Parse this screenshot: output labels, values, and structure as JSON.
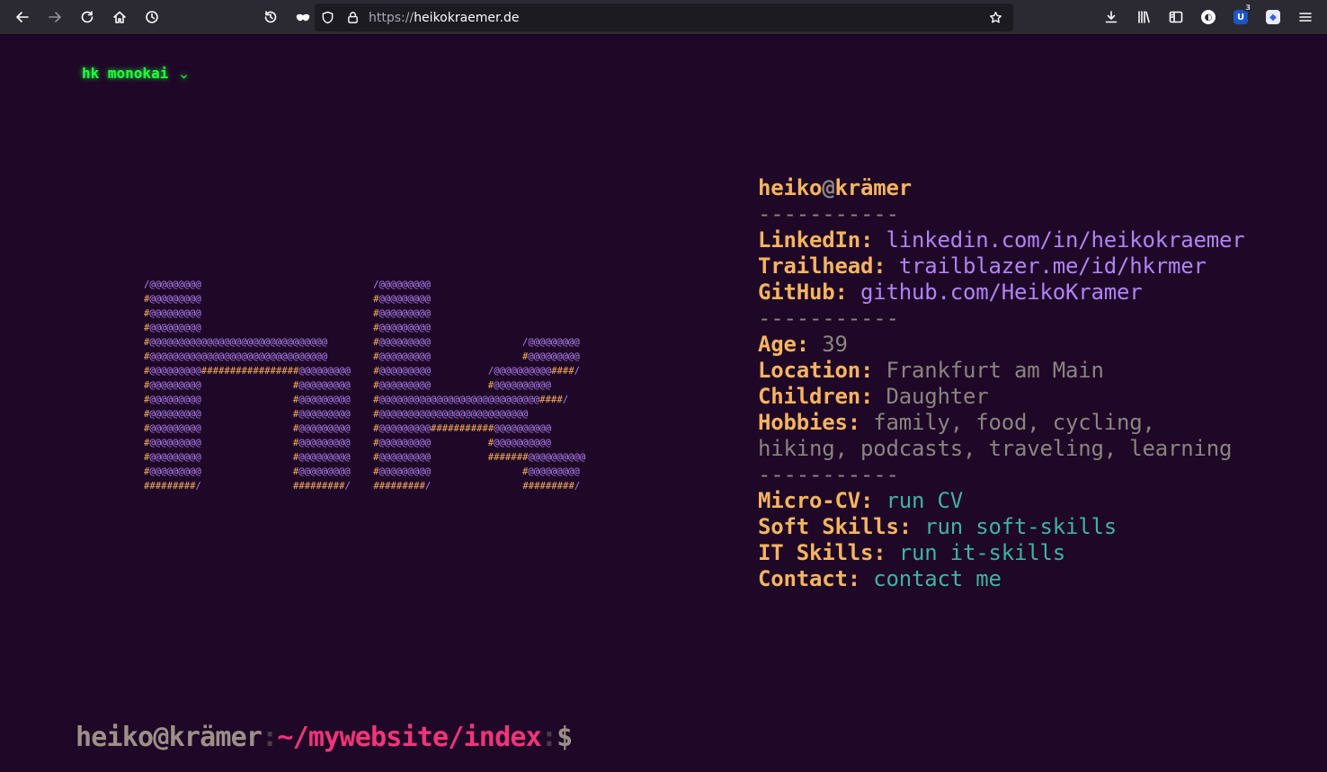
{
  "browser": {
    "url_scheme": "https://",
    "url_host": "heikokraemer.de",
    "extension_badge_count": "3"
  },
  "theme": {
    "label": "hk monokai",
    "caret": "⌄"
  },
  "logo": {
    "lines": [
      "/@@@@@@@@@                              /@@@@@@@@@",
      "#@@@@@@@@@                              #@@@@@@@@@",
      "#@@@@@@@@@                              #@@@@@@@@@",
      "#@@@@@@@@@                              #@@@@@@@@@",
      "#@@@@@@@@@@@@@@@@@@@@@@@@@@@@@@@        #@@@@@@@@@                /@@@@@@@@@",
      "#@@@@@@@@@@@@@@@@@@@@@@@@@@@@@@@        #@@@@@@@@@                #@@@@@@@@@",
      "#@@@@@@@@@#################@@@@@@@@@    #@@@@@@@@@          /@@@@@@@@@@####/",
      "#@@@@@@@@@                #@@@@@@@@@    #@@@@@@@@@          #@@@@@@@@@@",
      "#@@@@@@@@@                #@@@@@@@@@    #@@@@@@@@@@@@@@@@@@@@@@@@@@@@####/",
      "#@@@@@@@@@                #@@@@@@@@@    #@@@@@@@@@@@@@@@@@@@@@@@@@@",
      "#@@@@@@@@@                #@@@@@@@@@    #@@@@@@@@@###########@@@@@@@@@@",
      "#@@@@@@@@@                #@@@@@@@@@    #@@@@@@@@@          #@@@@@@@@@@",
      "#@@@@@@@@@                #@@@@@@@@@    #@@@@@@@@@          #######@@@@@@@@@@",
      "#@@@@@@@@@                #@@@@@@@@@    #@@@@@@@@@                #@@@@@@@@@",
      "#########/                #########/    #########/                #########/"
    ]
  },
  "info": {
    "title_user": "heiko",
    "title_at": "@",
    "title_host": "krämer",
    "separator": "-----------",
    "links": [
      {
        "key": "LinkedIn:",
        "value": "linkedin.com/in/heikokraemer"
      },
      {
        "key": "Trailhead:",
        "value": "trailblazer.me/id/hkrmer"
      },
      {
        "key": "GitHub:",
        "value": "github.com/HeikoKramer"
      }
    ],
    "facts": [
      {
        "key": "Age:",
        "value": "39"
      },
      {
        "key": "Location:",
        "value": "Frankfurt am Main"
      },
      {
        "key": "Children:",
        "value": "Daughter"
      },
      {
        "key": "Hobbies:",
        "value": "family, food, cycling,"
      }
    ],
    "hobbies_cont": "hiking, podcasts, traveling, learning",
    "commands": [
      {
        "key": "Micro-CV:",
        "value": "run CV"
      },
      {
        "key": "Soft Skills:",
        "value": "run soft-skills"
      },
      {
        "key": "IT Skills:",
        "value": "run it-skills"
      },
      {
        "key": "Contact:",
        "value": "contact me"
      }
    ]
  },
  "prompt": {
    "user": "heiko@krämer",
    "colon1": ":",
    "path": "~/mywebsite/index",
    "colon2": ":",
    "dollar": "$"
  },
  "colors": {
    "background": "#1f0727",
    "theme_green": "#21ff3d",
    "key_orange": "#f5b45f",
    "link_purple": "#b083f5",
    "command_teal": "#3fb3a3",
    "path_pink": "#f2347a",
    "muted_gray": "#8a8480"
  }
}
